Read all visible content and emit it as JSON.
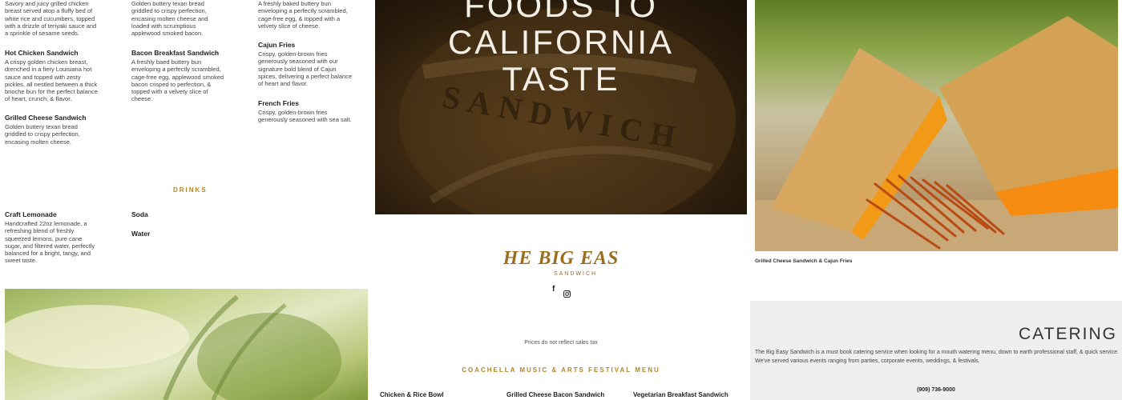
{
  "col1": [
    {
      "title": "",
      "desc": "Savory and juicy grilled chicken breast served atop a fluffy bed of white rice and cucumbers, topped with a drizzle of teriyaki sauce and a sprinkle of sesame seeds."
    },
    {
      "title": "Hot Chicken Sandwich",
      "desc": "A crispy golden chicken breast, drenched in a fiery Louisiana hot sauce and topped with zesty pickles, all nestled between a thick brioche bun for the perfect balance of heart, crunch, & flavor."
    },
    {
      "title": "Grilled Cheese Sandwich",
      "desc": "Golden buttery texan bread griddled to crispy perfection, encasing molten cheese."
    }
  ],
  "col2": [
    {
      "title": "",
      "desc": "Golden buttery texan bread griddled to crispy perfection, encasing molten cheese and loaded with scrumptious applewood smoked bacon."
    },
    {
      "title": "Bacon Breakfast Sandwich",
      "desc": "A freshly baed buttery bun enveloping a perfectly scrambled, cage-free egg, applewood smoked bacon crisped to perfection, & topped with a velvety slice of cheese."
    }
  ],
  "col3": [
    {
      "title": "",
      "desc": "A freshly baked buttery bun enveloping a perfectly scrambled, cage-free egg, & topped with a velvety slice of cheese."
    },
    {
      "title": "Cajun Fries",
      "desc": "Crispy, golden-brown fries generously seasoned with our signature bold blend of Cajun spices, delivering a perfect balance of heart and flavor."
    },
    {
      "title": "French Fries",
      "desc": "Crispy, golden-brown fries generously seasoned with sea salt."
    }
  ],
  "drinks_heading": "DRINKS",
  "drinks": [
    {
      "title": "Craft Lemonade",
      "desc": "Handcrafted 22oz lemonade, a refreshing blend of freshly squeezed lemons, pure cane sugar, and filtered water, perfectly balanced for a bright, tangy, and sweet taste."
    },
    {
      "title": "Soda",
      "desc": ""
    },
    {
      "title": "Water",
      "desc": ""
    }
  ],
  "hero": {
    "line1": "FOODS TO CALIFORNIA",
    "line2": "TASTE",
    "sign_text": "SANDWICH"
  },
  "logo": {
    "line1": "THE BIG EASY",
    "line2": "SANDWICH"
  },
  "social": {
    "facebook": "f",
    "instagram": "instagram-icon"
  },
  "photo_caption": "Grilled Cheese Sandwich & Cajun Fries",
  "prices_note": "Prices do not reflect sales tax",
  "festival_heading": "COACHELLA MUSIC & ARTS FESTIVAL MENU",
  "festival_items": [
    "Chicken & Rice Bowl",
    "Grilled Cheese Bacon Sandwich",
    "Vegetarian Breakfast Sandwich"
  ],
  "catering": {
    "heading": "CATERING",
    "text": "The Big Easy Sandwich is a must book catering service when looking for a mouth watering menu, down to earth professional staff, & quick service. We've served various events ranging from parties, corporate events, weddings, & festivals.",
    "phone": "(909) 736-9000"
  },
  "colors": {
    "accent": "#b0862b",
    "hero_bg": "#3a2812",
    "catering_bg": "#efefef"
  }
}
